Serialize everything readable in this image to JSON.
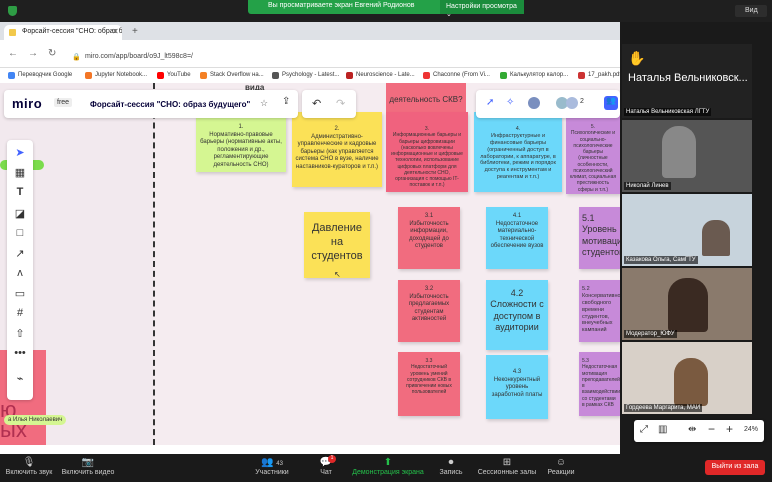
{
  "zoom_top": {
    "banner": "Вы просматриваете экран Евгений Родионов",
    "share_settings": "Настройки просмотра ⌄",
    "view_label": "Вид"
  },
  "browser": {
    "tab_title": "Форсайт-сессия \"СНО: образ б...",
    "url": "miro.com/app/board/o9J_lt598c8=/",
    "bookmarks": [
      "Переводчик Google",
      "Jupyter Notebook...",
      "YouTube",
      "Stack Overflow на...",
      "Psychology - Latest...",
      "Neuroscience - Late...",
      "Chaconne (From Vi...",
      "Калькулятор калор...",
      "17_pakh.pdf"
    ]
  },
  "miro": {
    "logo": "miro",
    "plan": "free",
    "board_title": "Форсайт-сессия \"СНО: образ будущего\"",
    "participants_count": "2",
    "partial_text_top": "деятельность СКВ?",
    "partial_text_top2": "вида",
    "cursor_label_left": "а Илья Николаевич",
    "side_letters": "ю\nых"
  },
  "stickies": [
    {
      "id": "s1",
      "text": "1.\nНормативно-правовые барьеры (нормативные акты, положения и др., регламентирующие деятельность СНО)",
      "color": "green"
    },
    {
      "id": "s2",
      "text": "2.\nАдминистративно-управленческие и кадровые барьеры (как управляется система СНО в вузе, наличие наставников-кураторов и т.п.)",
      "color": "yellow"
    },
    {
      "id": "s3",
      "text": "3.\nИнформационные барьеры и барьеры цифровизации (насколько вовлечены информационные и цифровые технологии, использование цифровых платформ для деятельности СНО, организация с помощью IT-поставок и т.п.)",
      "color": "red"
    },
    {
      "id": "s4",
      "text": "4.\nИнфраструктурные и финансовые барьеры (ограниченный доступ в лаборатории, к аппаратуре, в библиотеки, режим и порядок доступа к инструментам и реагентам и т.п.)",
      "color": "blue"
    },
    {
      "id": "s5",
      "text": "5.\nПсихологические и социально-психологические барьеры (личностные особенности, психологический климат, социальная престижность сферы и т.п.)",
      "color": "purple"
    },
    {
      "id": "s6",
      "text": "Давление на студентов",
      "color": "yellow"
    },
    {
      "id": "s7",
      "text": "3.1\nИзбыточность информации, доходящей до студентов",
      "color": "pink"
    },
    {
      "id": "s8",
      "text": "4.1\nНедостаточное материально-технической обеспечение вузов",
      "color": "blue"
    },
    {
      "id": "s9",
      "text": "5.1\nУровень мотивации студентов",
      "color": "purple"
    },
    {
      "id": "s10",
      "text": "3.2\nИзбыточность предлагаемых студентам активностей",
      "color": "pink"
    },
    {
      "id": "s11",
      "text": "4.2\nСложности с доступом в аудитории",
      "color": "blue"
    },
    {
      "id": "s12",
      "text": "5.2\nКонсервативность свободного времени студентов, внеучебных кампаний",
      "color": "purple"
    },
    {
      "id": "s13",
      "text": "3.3\nНедостаточный уровень умений сотрудников СКВ в привлечении новых пользователей",
      "color": "pink"
    },
    {
      "id": "s14",
      "text": "4.3\nНеконкурентный уровень заработной платы",
      "color": "blue"
    },
    {
      "id": "s15",
      "text": "5.3\nНедостаточная мотивация преподавателей в взаимодействии со студентами в рамках СКВ",
      "color": "purple"
    }
  ],
  "participants": [
    {
      "name": "Наталья Вельниковская ЛГТУ",
      "big_name": "Наталья Вельниковск...",
      "hand": "✋"
    },
    {
      "name": "Николай Линев"
    },
    {
      "name": "Казакова Ольга, СамГТУ"
    },
    {
      "name": "Модератор_ЮФУ"
    },
    {
      "name": "Гордеева Маргарита, МАИ"
    }
  ],
  "zoom_level": "24%",
  "zoom_bottom": {
    "mic": "Включить звук",
    "video": "Включить видео",
    "participants": "Участники",
    "participants_count": "43",
    "chat": "Чат",
    "chat_badge": "1",
    "share": "Демонстрация экрана",
    "record": "Запись",
    "breakout": "Сессионные залы",
    "reactions": "Реакции",
    "leave": "Выйти из зала"
  }
}
